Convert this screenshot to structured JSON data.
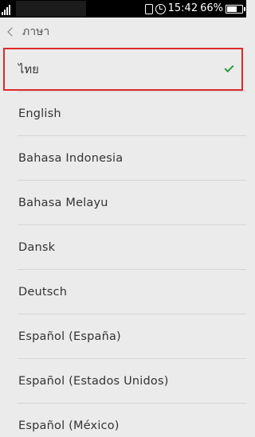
{
  "status_bar": {
    "time": "15:42",
    "battery_text": "66%",
    "battery_level": 0.66
  },
  "header": {
    "title": "ภาษา"
  },
  "languages": [
    {
      "label": "ไทย",
      "selected": true
    },
    {
      "label": "English"
    },
    {
      "label": "Bahasa Indonesia"
    },
    {
      "label": "Bahasa Melayu"
    },
    {
      "label": "Dansk"
    },
    {
      "label": "Deutsch"
    },
    {
      "label": "Español (España)"
    },
    {
      "label": "Español (Estados Unidos)"
    },
    {
      "label": "Español (México)"
    }
  ],
  "colors": {
    "accent_check": "#2a9a3c",
    "highlight_border": "#e02828"
  },
  "icons": [
    "sim-signal-icon",
    "vibrate-icon",
    "alarm-icon",
    "battery-icon",
    "back-chevron-icon",
    "checkmark-icon"
  ]
}
